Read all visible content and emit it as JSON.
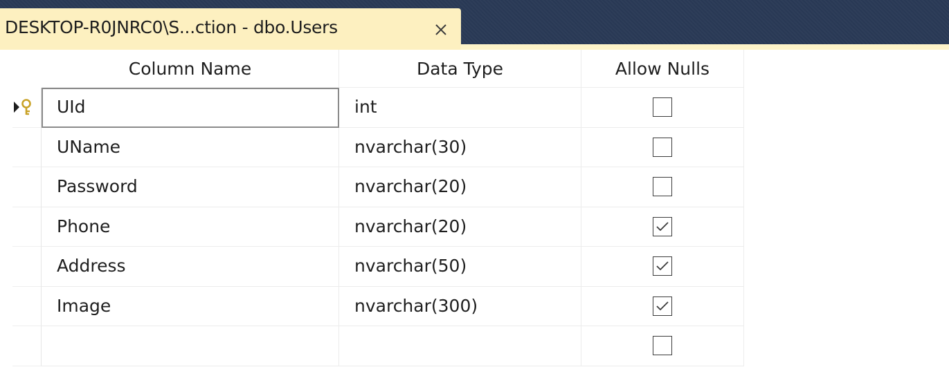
{
  "tab": {
    "title": "DESKTOP-R0JNRC0\\S...ction - dbo.Users",
    "close_icon": "close-icon"
  },
  "headers": {
    "column_name": "Column Name",
    "data_type": "Data Type",
    "allow_nulls": "Allow Nulls"
  },
  "rows": [
    {
      "name": "UId",
      "type": "int",
      "allow_nulls": false,
      "primary_key": true,
      "current": true
    },
    {
      "name": "UName",
      "type": "nvarchar(30)",
      "allow_nulls": false
    },
    {
      "name": "Password",
      "type": "nvarchar(20)",
      "allow_nulls": false
    },
    {
      "name": "Phone",
      "type": "nvarchar(20)",
      "allow_nulls": true
    },
    {
      "name": "Address",
      "type": "nvarchar(50)",
      "allow_nulls": true
    },
    {
      "name": "Image",
      "type": "nvarchar(300)",
      "allow_nulls": true
    },
    {
      "name": "",
      "type": "",
      "allow_nulls": false
    }
  ],
  "colors": {
    "tab_strip": "#293955",
    "active_tab": "#fdf0c0",
    "key_icon": "#c9a227"
  }
}
